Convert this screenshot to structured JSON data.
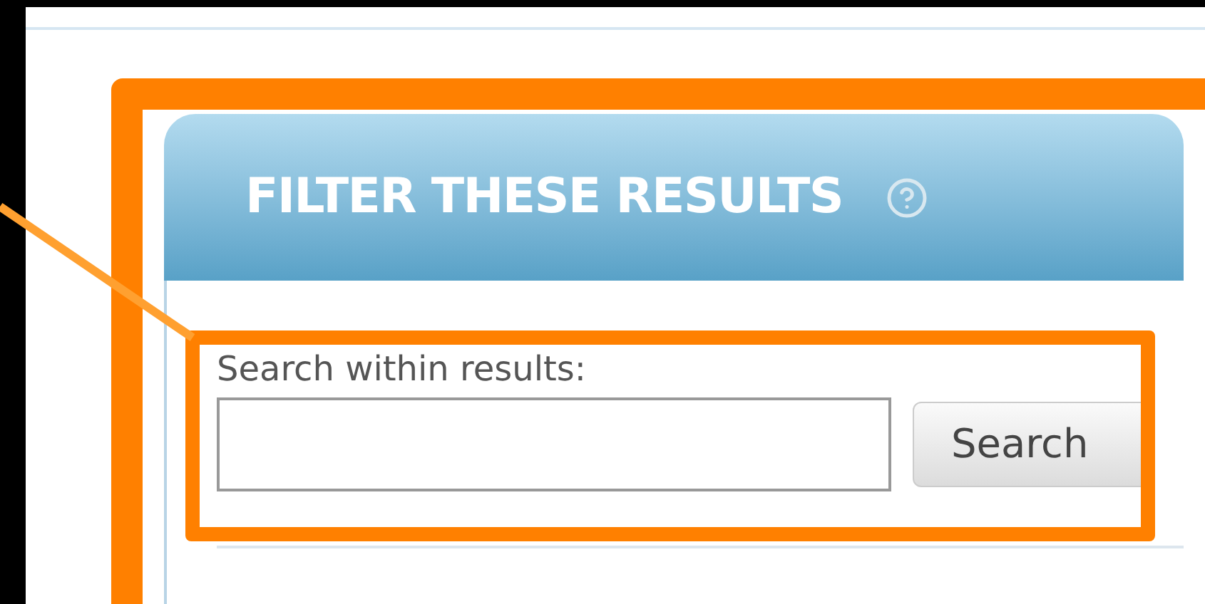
{
  "panel": {
    "title": "FILTER THESE RESULTS",
    "search_label": "Search within results:",
    "search_button": "Search"
  }
}
